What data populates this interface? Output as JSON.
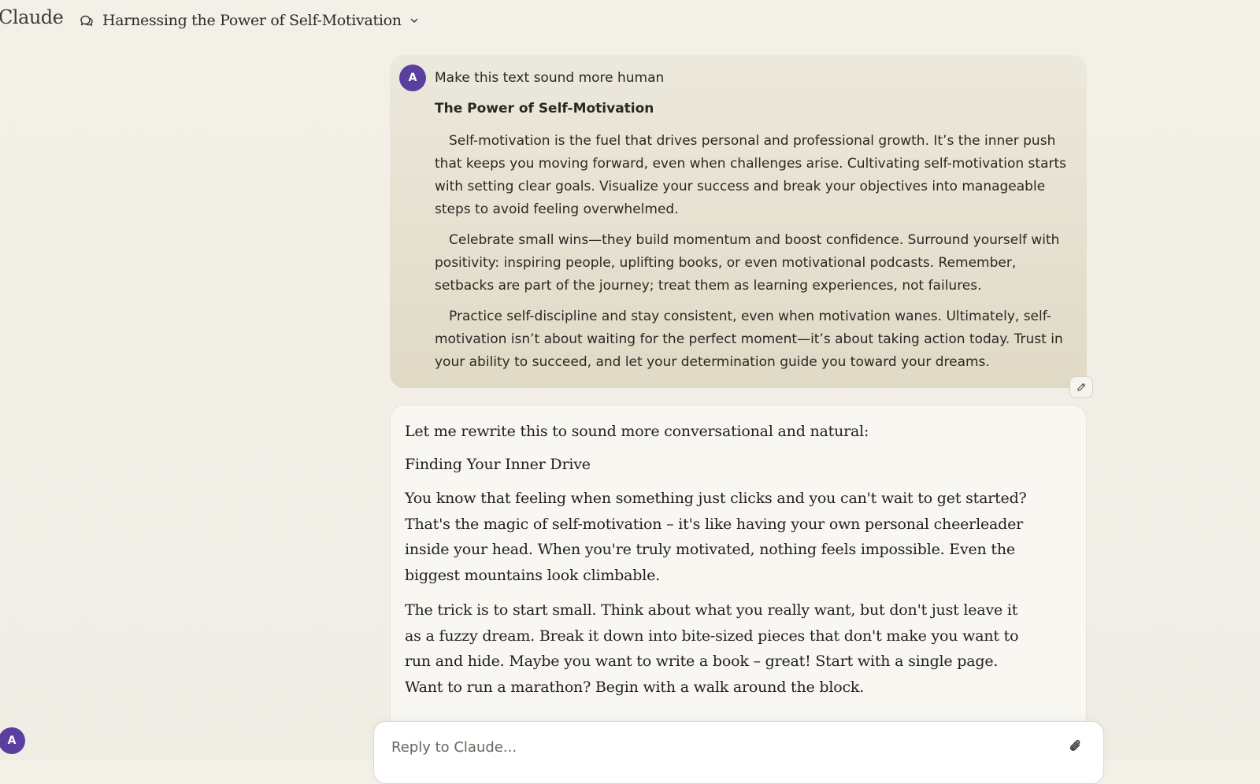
{
  "app": {
    "name": "Claude"
  },
  "header": {
    "chat_title": "Harnessing the Power of Self-Motivation"
  },
  "user_message": {
    "avatar_initial": "A",
    "prompt": "Make this text sound more human",
    "heading": "The Power of Self-Motivation",
    "paragraphs": [
      "Self-motivation is the fuel that drives personal and professional growth. It’s the inner push that keeps you moving forward, even when challenges arise. Cultivating self-motivation starts with setting clear goals. Visualize your success and break your objectives into manageable steps to avoid feeling overwhelmed.",
      "Celebrate small wins—they build momentum and boost confidence. Surround yourself with positivity: inspiring people, uplifting books, or even motivational podcasts. Remember, setbacks are part of the journey; treat them as learning experiences, not failures.",
      "Practice self-discipline and stay consistent, even when motivation wanes. Ultimately, self-motivation isn’t about waiting for the perfect moment—it’s about taking action today. Trust in your ability to succeed, and let your determination guide you toward your dreams."
    ]
  },
  "assistant_message": {
    "intro": "Let me rewrite this to sound more conversational and natural:",
    "heading": "Finding Your Inner Drive",
    "paragraphs": [
      "You know that feeling when something just clicks and you can't wait to get started? That's the magic of self-motivation – it's like having your own personal cheerleader inside your head. When you're truly motivated, nothing feels impossible. Even the biggest mountains look climbable.",
      "The trick is to start small. Think about what you really want, but don't just leave it as a fuzzy dream. Break it down into bite-sized pieces that don't make you want to run and hide. Maybe you want to write a book – great! Start with a single page. Want to run a marathon? Begin with a walk around the block."
    ]
  },
  "composer": {
    "placeholder": "Reply to Claude..."
  },
  "sidebar": {
    "user_initial": "A"
  },
  "colors": {
    "avatar": "#5b3fa0",
    "user_bubble": "#e6e0d0",
    "assistant_bubble": "#f8f7f2"
  }
}
